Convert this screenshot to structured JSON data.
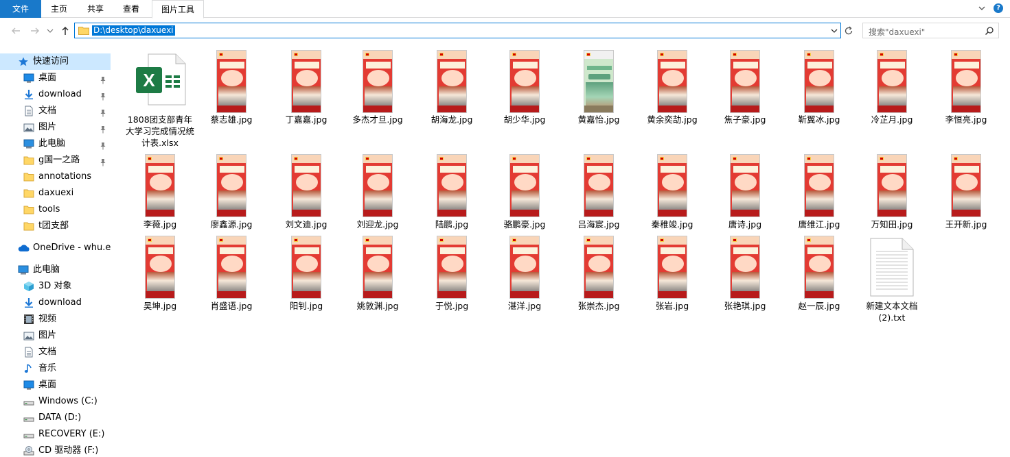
{
  "ribbon": {
    "tabs": [
      "文件",
      "主页",
      "共享",
      "查看",
      "图片工具"
    ]
  },
  "address": {
    "path": "D:\\desktop\\daxuexi",
    "search_placeholder": "搜索\"daxuexi\""
  },
  "sidebar": {
    "items": [
      {
        "label": "快速访问",
        "icon": "star-icon"
      },
      {
        "label": "桌面",
        "icon": "desktop-icon"
      },
      {
        "label": "download",
        "icon": "download-icon"
      },
      {
        "label": "文档",
        "icon": "document-icon"
      },
      {
        "label": "图片",
        "icon": "picture-icon"
      },
      {
        "label": "此电脑",
        "icon": "computer-icon"
      },
      {
        "label": "g国一之路",
        "icon": "folder-icon"
      },
      {
        "label": "annotations",
        "icon": "folder-icon"
      },
      {
        "label": "daxuexi",
        "icon": "folder-icon"
      },
      {
        "label": "tools",
        "icon": "folder-icon"
      },
      {
        "label": "t团支部",
        "icon": "folder-icon"
      },
      {
        "label": "OneDrive - whu.edu",
        "icon": "cloud-icon"
      },
      {
        "label": "此电脑",
        "icon": "computer-icon"
      },
      {
        "label": "3D 对象",
        "icon": "cube-icon"
      },
      {
        "label": "download",
        "icon": "download-icon"
      },
      {
        "label": "视频",
        "icon": "video-icon"
      },
      {
        "label": "图片",
        "icon": "picture-icon"
      },
      {
        "label": "文档",
        "icon": "document-icon"
      },
      {
        "label": "音乐",
        "icon": "music-icon"
      },
      {
        "label": "桌面",
        "icon": "desktop-icon"
      },
      {
        "label": "Windows (C:)",
        "icon": "drive-icon"
      },
      {
        "label": "DATA (D:)",
        "icon": "drive-icon"
      },
      {
        "label": "RECOVERY (E:)",
        "icon": "drive-icon"
      },
      {
        "label": "CD 驱动器 (F:)",
        "icon": "cd-drive-icon"
      }
    ]
  },
  "files": {
    "row1": [
      "1808团支部青年大学习完成情况统计表.xlsx",
      "蔡志雄.jpg",
      "丁嘉嘉.jpg",
      "多杰才旦.jpg",
      "胡海龙.jpg",
      "胡少华.jpg",
      "黄嘉怡.jpg",
      "黄余奕劼.jpg",
      "焦子豪.jpg",
      "靳翼冰.jpg",
      "冷芷月.jpg",
      "李恒亮.jpg"
    ],
    "row2": [
      "李薇.jpg",
      "廖鑫源.jpg",
      "刘文迪.jpg",
      "刘迎龙.jpg",
      "陆鹏.jpg",
      "骆鹏豪.jpg",
      "吕海宸.jpg",
      "秦稚竣.jpg",
      "唐诗.jpg",
      "唐维江.jpg",
      "万知田.jpg",
      "王开新.jpg"
    ],
    "row3": [
      "吴坤.jpg",
      "肖盛语.jpg",
      "阳钊.jpg",
      "姚敦渊.jpg",
      "于悦.jpg",
      "湛洋.jpg",
      "张崇杰.jpg",
      "张岩.jpg",
      "张艳琪.jpg",
      "赵一辰.jpg",
      "新建文本文档 (2).txt"
    ]
  },
  "colors": {
    "accent": "#0078d7",
    "file_tab": "#1979ca",
    "selected_bg": "#cce8ff",
    "excel_green": "#1d7b45"
  }
}
